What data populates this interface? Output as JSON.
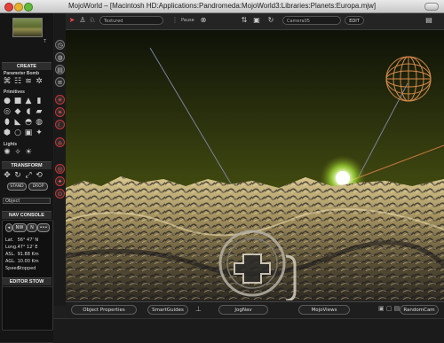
{
  "window": {
    "title": "MojoWorld – [Macintosh HD:Applications:Pandromeda:MojoWorld3:Libraries:Planets:Europa.mjw]"
  },
  "sidebar": {
    "thumb_tag": "T",
    "create": {
      "header": "CREATE",
      "parameter_bomb": "Parameter Bomb",
      "primitives": "Primitives",
      "lights": "Lights"
    },
    "transform": {
      "header": "TRANSFORM",
      "stand_label": "STAND",
      "drop_label": "DROP",
      "object_dropdown": "Object"
    },
    "nav_console": {
      "header": "NAV CONSOLE",
      "left_dir": "NW",
      "right_dir": "N",
      "rows": [
        {
          "key": "Lat.",
          "value": "56° 47' N"
        },
        {
          "key": "Long.",
          "value": "47° 12' E"
        },
        {
          "key": "ASL.",
          "value": "91.88 Km"
        },
        {
          "key": "AGL.",
          "value": "10.00 Km"
        },
        {
          "key": "Speed",
          "value": "Stopped"
        }
      ]
    },
    "editor_stow": "EDITOR STOW"
  },
  "toolbar": {
    "render_mode": "Textured",
    "pause_label": "Pause",
    "camera_label": "Camera05",
    "edit_label": "EDIT"
  },
  "bottombar": {
    "object_properties": "Object Properties",
    "smart_guides": "SmartGuides",
    "jog_nav": "JogNav",
    "mojo_views": "MojoViews",
    "random_cam": "RandomCam"
  },
  "colors": {
    "sky_top": "#0e1208",
    "sky_horizon": "#6f7a1a",
    "sun_glow": "#b7ff3a",
    "terrain_light": "#c9b27a",
    "terrain_dark": "#222226",
    "gizmo_orange": "#d2894a",
    "accent_red": "#cc3333"
  },
  "icons": [
    "arrow-icon",
    "walk-icon",
    "run-icon",
    "pause-icon",
    "camera-icon",
    "rotate-icon",
    "grid-icon",
    "move-icon"
  ]
}
